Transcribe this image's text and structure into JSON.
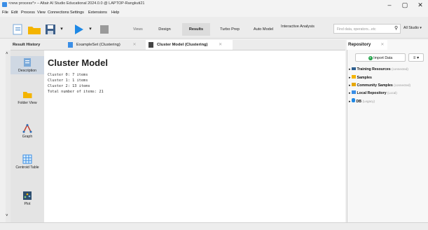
{
  "window": {
    "title": "<new process*> – Altair AI Studio Educational 2024.0.0 @ LAPTOP-Rangkuti21"
  },
  "menu": [
    "File",
    "Edit",
    "Process",
    "View",
    "Connections",
    "Settings",
    "Extensions",
    "Help"
  ],
  "toolbar": {
    "views_label": "Views",
    "views": [
      "Design",
      "Results",
      "Turbo Prep",
      "Auto Model",
      "Interactive Analysis"
    ],
    "active_view": "Results",
    "search_placeholder": "Find data, operators...etc",
    "studio_label": "All Studio"
  },
  "tabs": {
    "result_history": "Result History",
    "items": [
      "ExampleSet (Clustering)",
      "Cluster Model (Clustering)"
    ],
    "active": "Cluster Model (Clustering)"
  },
  "sidebar": {
    "items": [
      {
        "label": "Description",
        "icon": "description-icon",
        "selected": true
      },
      {
        "label": "Folder View",
        "icon": "folder-icon",
        "selected": false
      },
      {
        "label": "Graph",
        "icon": "graph-icon",
        "selected": false
      },
      {
        "label": "Centroid Table",
        "icon": "table-icon",
        "selected": false
      },
      {
        "label": "Plot",
        "icon": "plot-icon",
        "selected": false
      }
    ]
  },
  "content": {
    "title": "Cluster Model",
    "lines": [
      "Cluster 0: 7 items",
      "Cluster 1: 1 items",
      "Cluster 2: 13 items",
      "Total number of items: 21"
    ]
  },
  "repository": {
    "title": "Repository",
    "import_label": "Import Data",
    "items": [
      {
        "label": "Training Resources",
        "status": "(connected)",
        "icon": "training-icon"
      },
      {
        "label": "Samples",
        "status": "",
        "icon": "folder-icon"
      },
      {
        "label": "Community Samples",
        "status": "(connected)",
        "icon": "community-icon"
      },
      {
        "label": "Local Repository",
        "status": "(Local)",
        "icon": "local-repo-icon"
      },
      {
        "label": "DB",
        "status": "(Legacy)",
        "icon": "db-icon"
      }
    ]
  },
  "colors": {
    "accent": "#3a8ee6",
    "folder": "#f4b400",
    "play": "#1e88e5",
    "import_green": "#22a34a"
  }
}
